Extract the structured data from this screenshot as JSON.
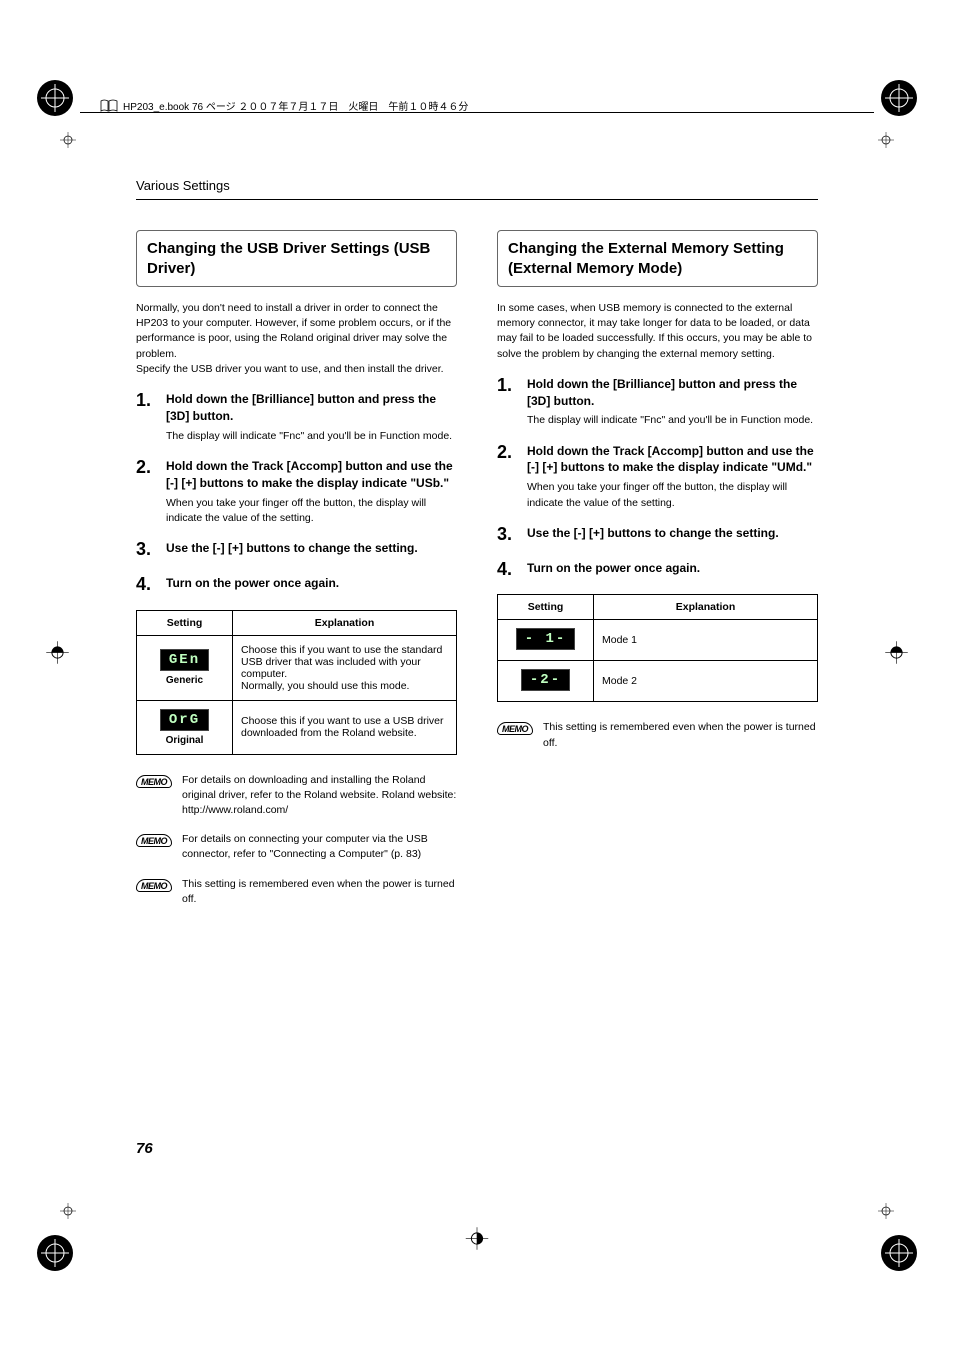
{
  "header_text": "HP203_e.book 76 ページ ２００７年７月１７日　火曜日　午前１０時４６分",
  "section_title": "Various Settings",
  "page_number": "76",
  "left": {
    "heading": "Changing the USB Driver Settings (USB Driver)",
    "intro": "Normally, you don't need to install a driver in order to connect the HP203 to your computer. However, if some problem occurs, or if the performance is poor, using the Roland original driver may solve the problem.\nSpecify the USB driver you want to use, and then install the driver.",
    "steps": [
      {
        "num": "1.",
        "head": "Hold down the [Brilliance] button and press the [3D] button.",
        "desc": "The display will indicate \"Fnc\" and you'll be in Function mode."
      },
      {
        "num": "2.",
        "head": "Hold down the Track [Accomp] button and use the [-] [+] buttons to make the display indicate \"USb.\"",
        "desc": "When you take your finger off the button, the display will indicate the value of the setting."
      },
      {
        "num": "3.",
        "head": "Use the [-] [+] buttons to change the setting.",
        "desc": ""
      },
      {
        "num": "4.",
        "head": "Turn on the power once again.",
        "desc": ""
      }
    ],
    "table": {
      "headers": [
        "Setting",
        "Explanation"
      ],
      "rows": [
        {
          "display": "GEn",
          "label": "Generic",
          "explanation": "Choose this if you want to use the standard USB driver that was included with your computer.\nNormally, you should use this mode."
        },
        {
          "display": "OrG",
          "label": "Original",
          "explanation": "Choose this if you want to use a USB driver downloaded from the Roland website."
        }
      ]
    },
    "memos": [
      {
        "label": "MEMO",
        "text": "For details on downloading and installing the Roland original driver, refer to the Roland website. Roland website:\nhttp://www.roland.com/"
      },
      {
        "label": "MEMO",
        "text": "For details on connecting your computer via the USB connector, refer to \"Connecting a Computer\" (p. 83)"
      },
      {
        "label": "MEMO",
        "text": "This setting is remembered even when the power is turned off."
      }
    ]
  },
  "right": {
    "heading": "Changing the External Memory Setting (External Memory Mode)",
    "intro": "In some cases, when USB memory is connected to the external memory connector, it may take longer for data to be loaded, or data may fail to be loaded successfully. If this occurs, you may be able to solve the problem by changing the external memory setting.",
    "steps": [
      {
        "num": "1.",
        "head": "Hold down the [Brilliance] button and press the [3D] button.",
        "desc": "The display will indicate \"Fnc\" and you'll be in Function mode."
      },
      {
        "num": "2.",
        "head": "Hold down the Track [Accomp] button and use the [-] [+] buttons to make the display indicate \"UMd.\"",
        "desc": "When you take your finger off the button, the display will indicate the value of the setting."
      },
      {
        "num": "3.",
        "head": "Use the [-] [+] buttons to change the setting.",
        "desc": ""
      },
      {
        "num": "4.",
        "head": "Turn on the power once again.",
        "desc": ""
      }
    ],
    "table": {
      "headers": [
        "Setting",
        "Explanation"
      ],
      "rows": [
        {
          "display": "- 1-",
          "label": "",
          "explanation": "Mode 1"
        },
        {
          "display": "-2-",
          "label": "",
          "explanation": "Mode 2"
        }
      ]
    },
    "memos": [
      {
        "label": "MEMO",
        "text": "This setting is remembered even when the power is turned off."
      }
    ]
  }
}
